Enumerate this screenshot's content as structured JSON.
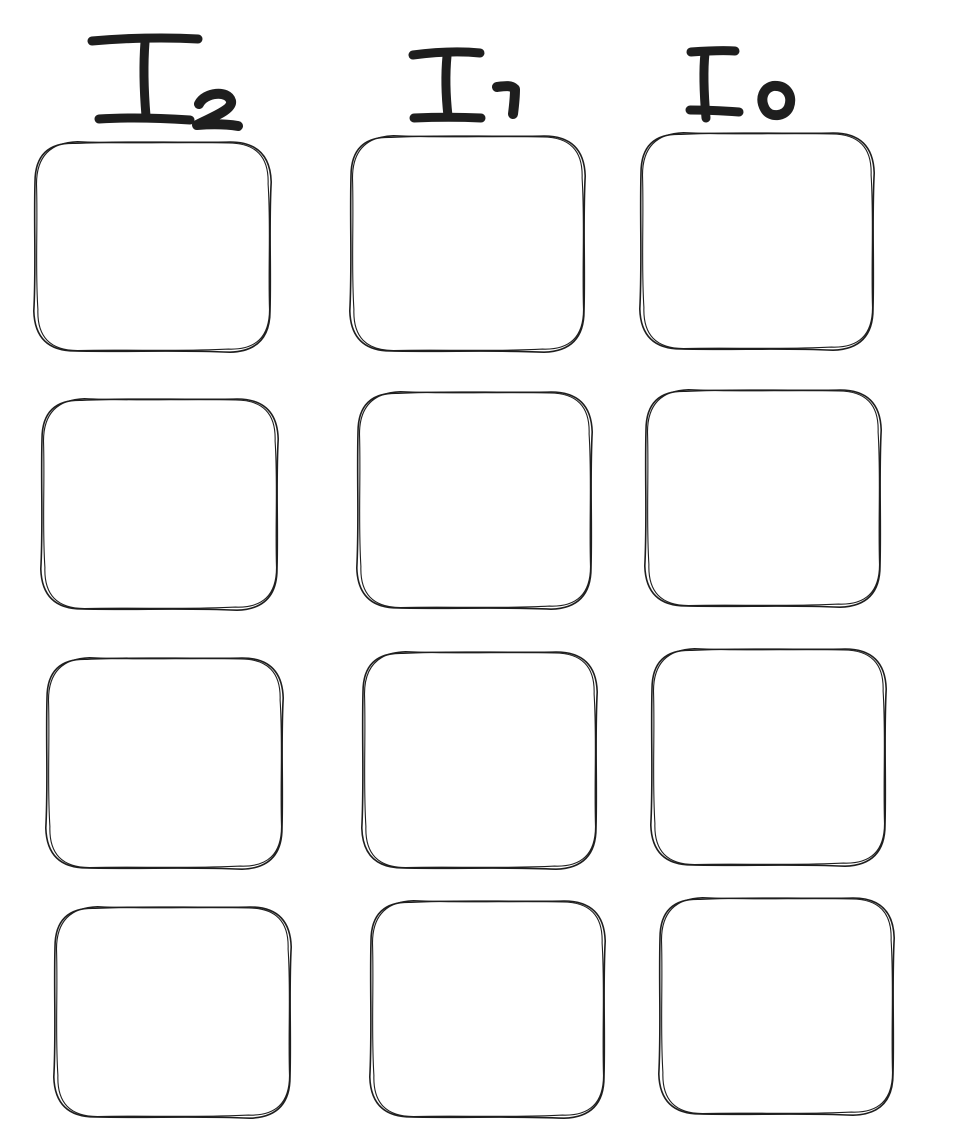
{
  "columns": [
    {
      "label": "I2"
    },
    {
      "label": "I1"
    },
    {
      "label": "I0"
    }
  ],
  "rows": 4,
  "colors": {
    "stroke": "#1e1e1e",
    "background": "#ffffff"
  }
}
